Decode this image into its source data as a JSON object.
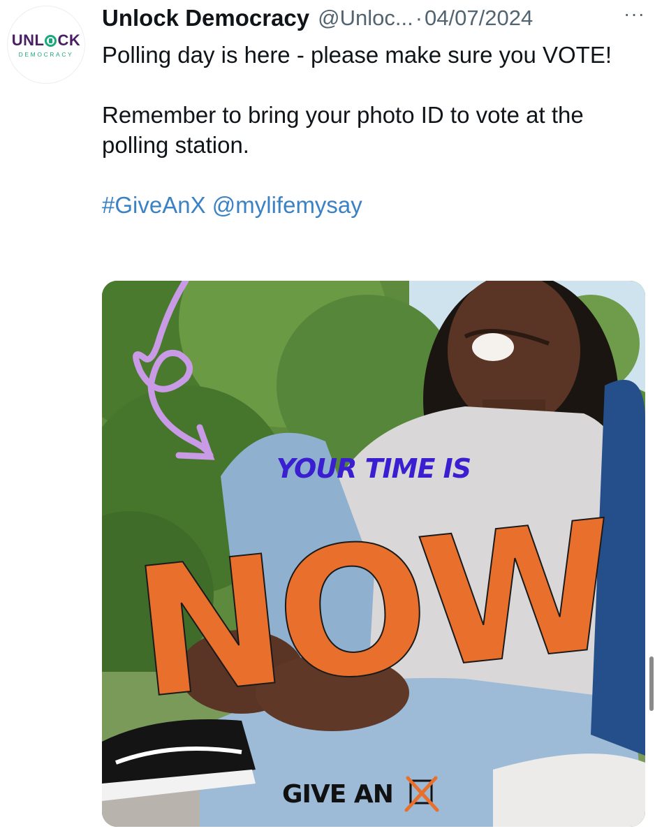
{
  "tweet": {
    "avatar": {
      "line1": "UNL",
      "line1_end": "CK",
      "line2": "DEMOCRACY"
    },
    "author_name": "Unlock Democracy",
    "author_handle": "@Unloc...",
    "separator": "·",
    "date": "04/07/2024",
    "more_label": "···",
    "text_line1": "Polling day is here - please make sure you VOTE!",
    "text_line2": "Remember to bring your photo ID to vote at the polling station.",
    "hashtag": "#GiveAnX",
    "mention": "@mylifemysay"
  },
  "media": {
    "headline": "YOUR TIME IS",
    "big_word": "NOW",
    "footer": "GIVE AN"
  },
  "colors": {
    "link": "#3b82c4",
    "headline": "#3a1fd1",
    "now": "#e8702c",
    "arrow": "#c99be6"
  }
}
